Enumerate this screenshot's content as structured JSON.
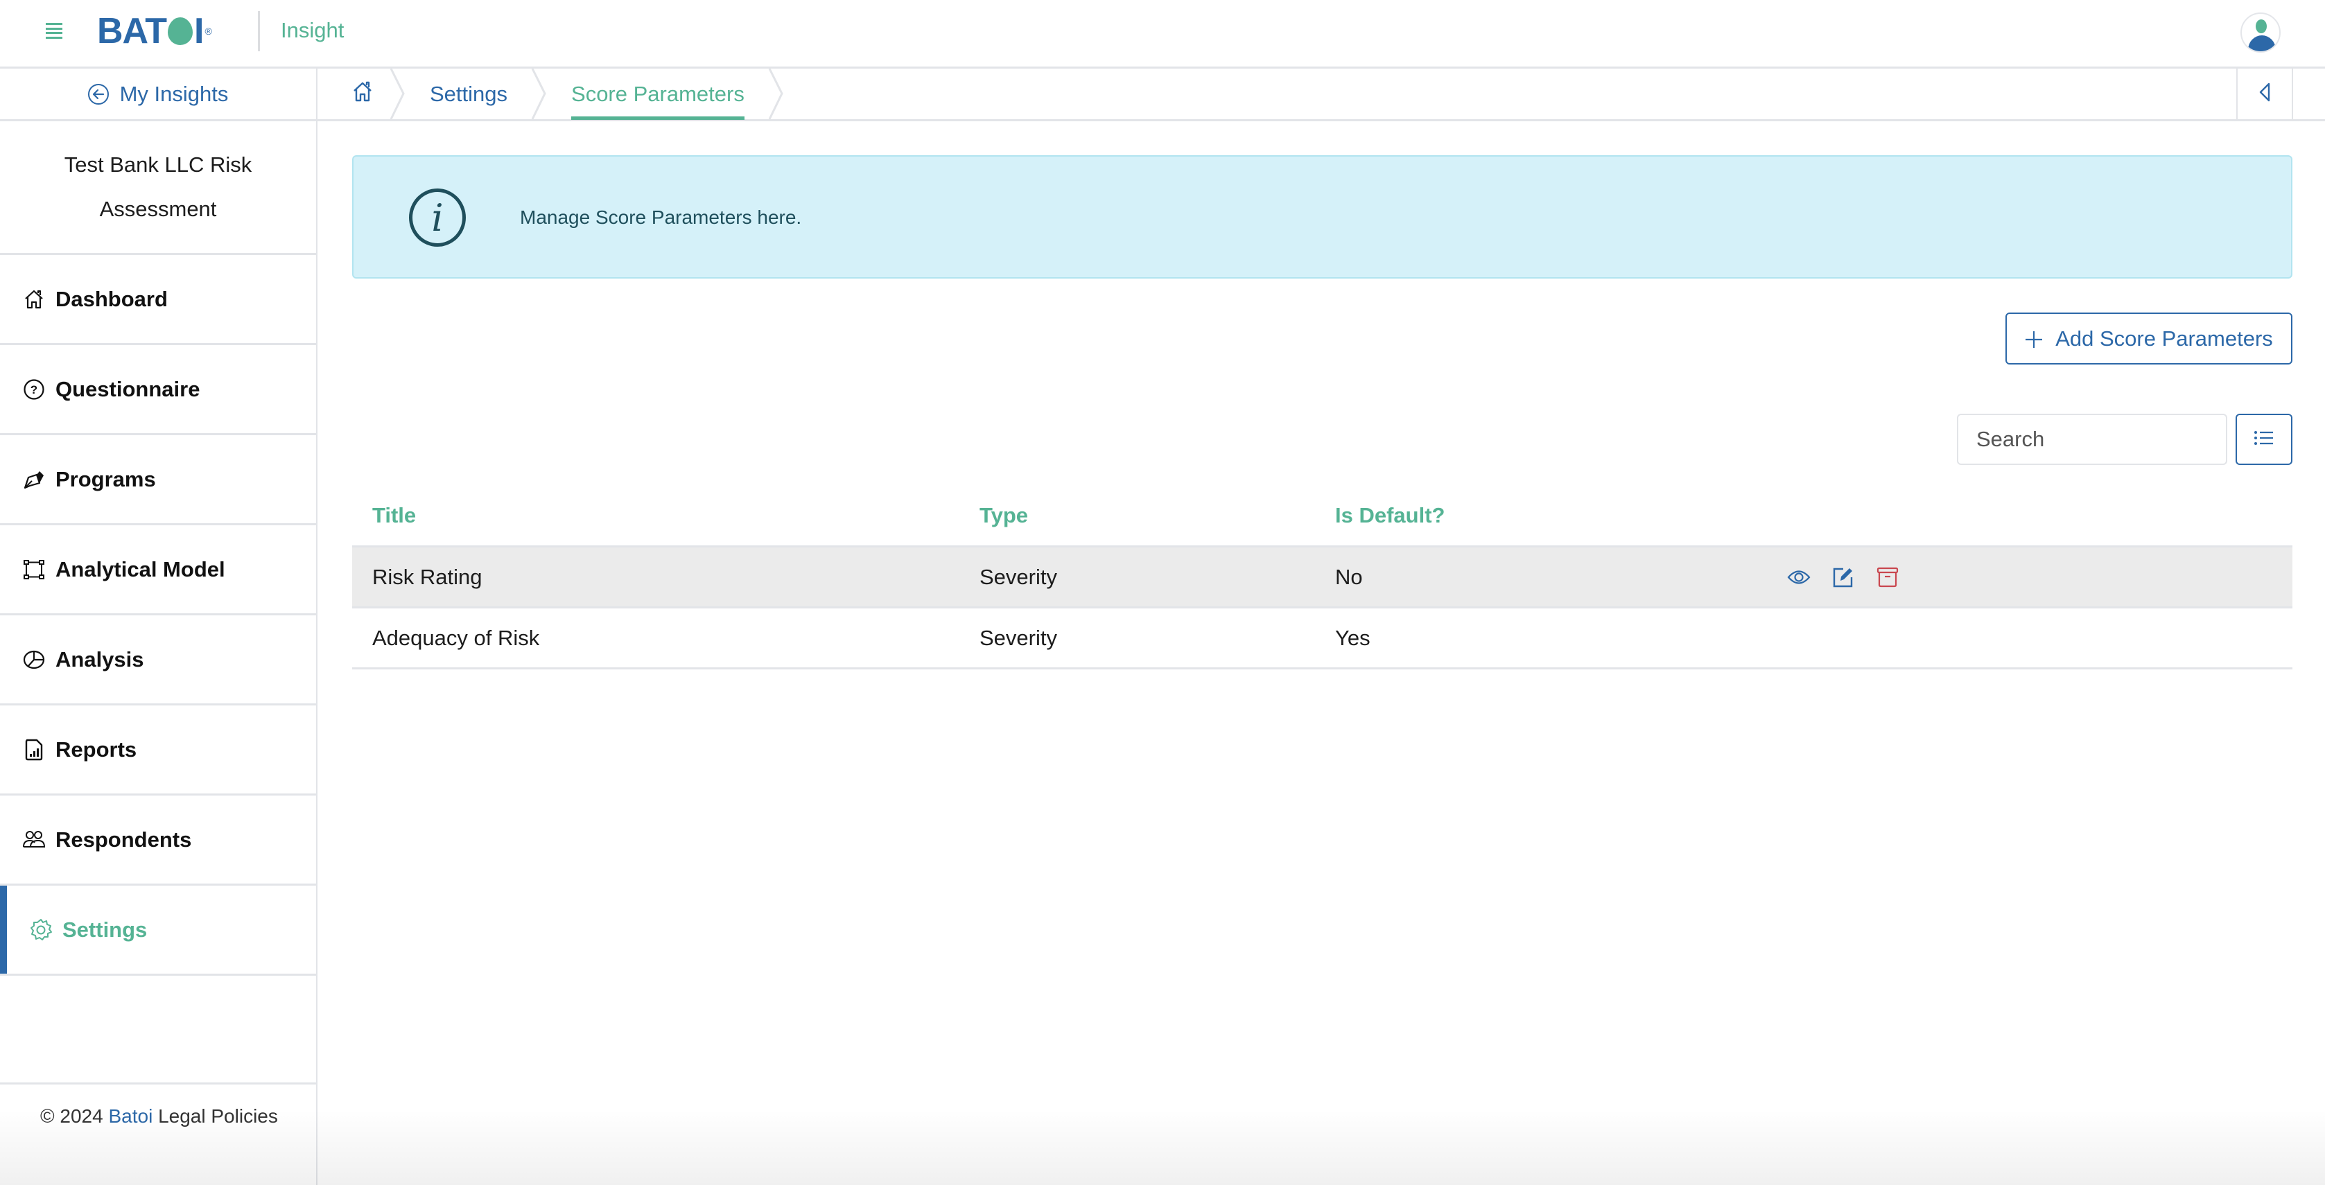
{
  "header": {
    "logo_text": "BAT",
    "logo_text_tail": "I",
    "logo_reg": "®",
    "app_name": "Insight",
    "icons": {
      "menu": "hamburger-icon",
      "avatar": "user-avatar-icon"
    }
  },
  "subbar": {
    "back_label": "My Insights",
    "breadcrumb": [
      {
        "label": "",
        "icon": "home-icon"
      },
      {
        "label": "Settings"
      },
      {
        "label": "Score Parameters",
        "current": true
      }
    ],
    "collapse_icon": "chevron-left-icon"
  },
  "sidebar": {
    "project_title": "Test Bank LLC Risk Assessment",
    "items": [
      {
        "label": "Dashboard",
        "icon": "home-icon"
      },
      {
        "label": "Questionnaire",
        "icon": "question-circle-icon"
      },
      {
        "label": "Programs",
        "icon": "pen-nib-icon"
      },
      {
        "label": "Analytical Model",
        "icon": "bounding-box-icon"
      },
      {
        "label": "Analysis",
        "icon": "pie-chart-icon"
      },
      {
        "label": "Reports",
        "icon": "report-file-icon"
      },
      {
        "label": "Respondents",
        "icon": "people-icon"
      },
      {
        "label": "Settings",
        "icon": "gear-icon",
        "active": true
      }
    ],
    "footer": {
      "copyright": "© 2024",
      "brand": "Batoi",
      "legal": "Legal Policies"
    }
  },
  "main": {
    "info": {
      "text": "Manage Score Parameters here.",
      "icon": "info-icon"
    },
    "add_button_label": "Add Score Parameters",
    "search": {
      "placeholder": "Search",
      "value": ""
    },
    "table": {
      "columns": [
        "Title",
        "Type",
        "Is Default?"
      ],
      "rows": [
        {
          "title": "Risk Rating",
          "type": "Severity",
          "is_default": "No",
          "actions": [
            "view",
            "edit",
            "archive"
          ]
        },
        {
          "title": "Adequacy of Risk",
          "type": "Severity",
          "is_default": "Yes",
          "actions": []
        }
      ]
    }
  },
  "colors": {
    "primary_blue": "#2c68a8",
    "accent_green": "#55b394",
    "info_bg": "#d5f1f9",
    "danger_red": "#c9474f",
    "hover_row": "#ebebeb"
  }
}
